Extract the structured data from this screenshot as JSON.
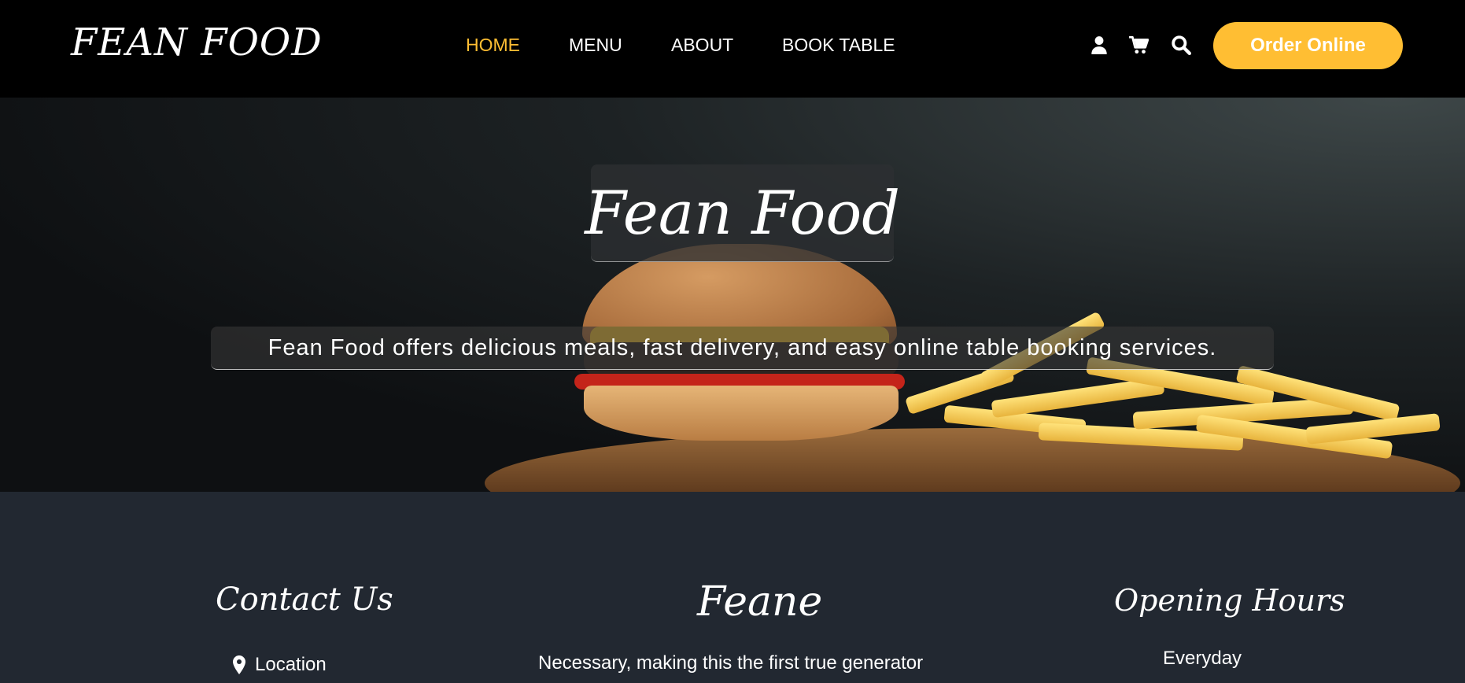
{
  "header": {
    "logo": "FEAN FOOD",
    "nav": [
      {
        "label": "HOME",
        "active": true
      },
      {
        "label": "MENU",
        "active": false
      },
      {
        "label": "ABOUT",
        "active": false
      },
      {
        "label": "BOOK TABLE",
        "active": false
      }
    ],
    "icons": [
      "user-icon",
      "cart-icon",
      "search-icon"
    ],
    "order_button": "Order Online"
  },
  "hero": {
    "title": "Fean Food",
    "description": "Fean Food offers delicious meals, fast delivery, and easy online table booking services."
  },
  "footer": {
    "contact": {
      "heading": "Contact Us",
      "location": "Location"
    },
    "about": {
      "heading": "Feane",
      "text": "Necessary, making this the first true generator"
    },
    "hours": {
      "heading": "Opening Hours",
      "text": "Everyday"
    }
  },
  "colors": {
    "accent": "#ffbe33",
    "header_bg": "#000000",
    "footer_bg": "#222831"
  }
}
